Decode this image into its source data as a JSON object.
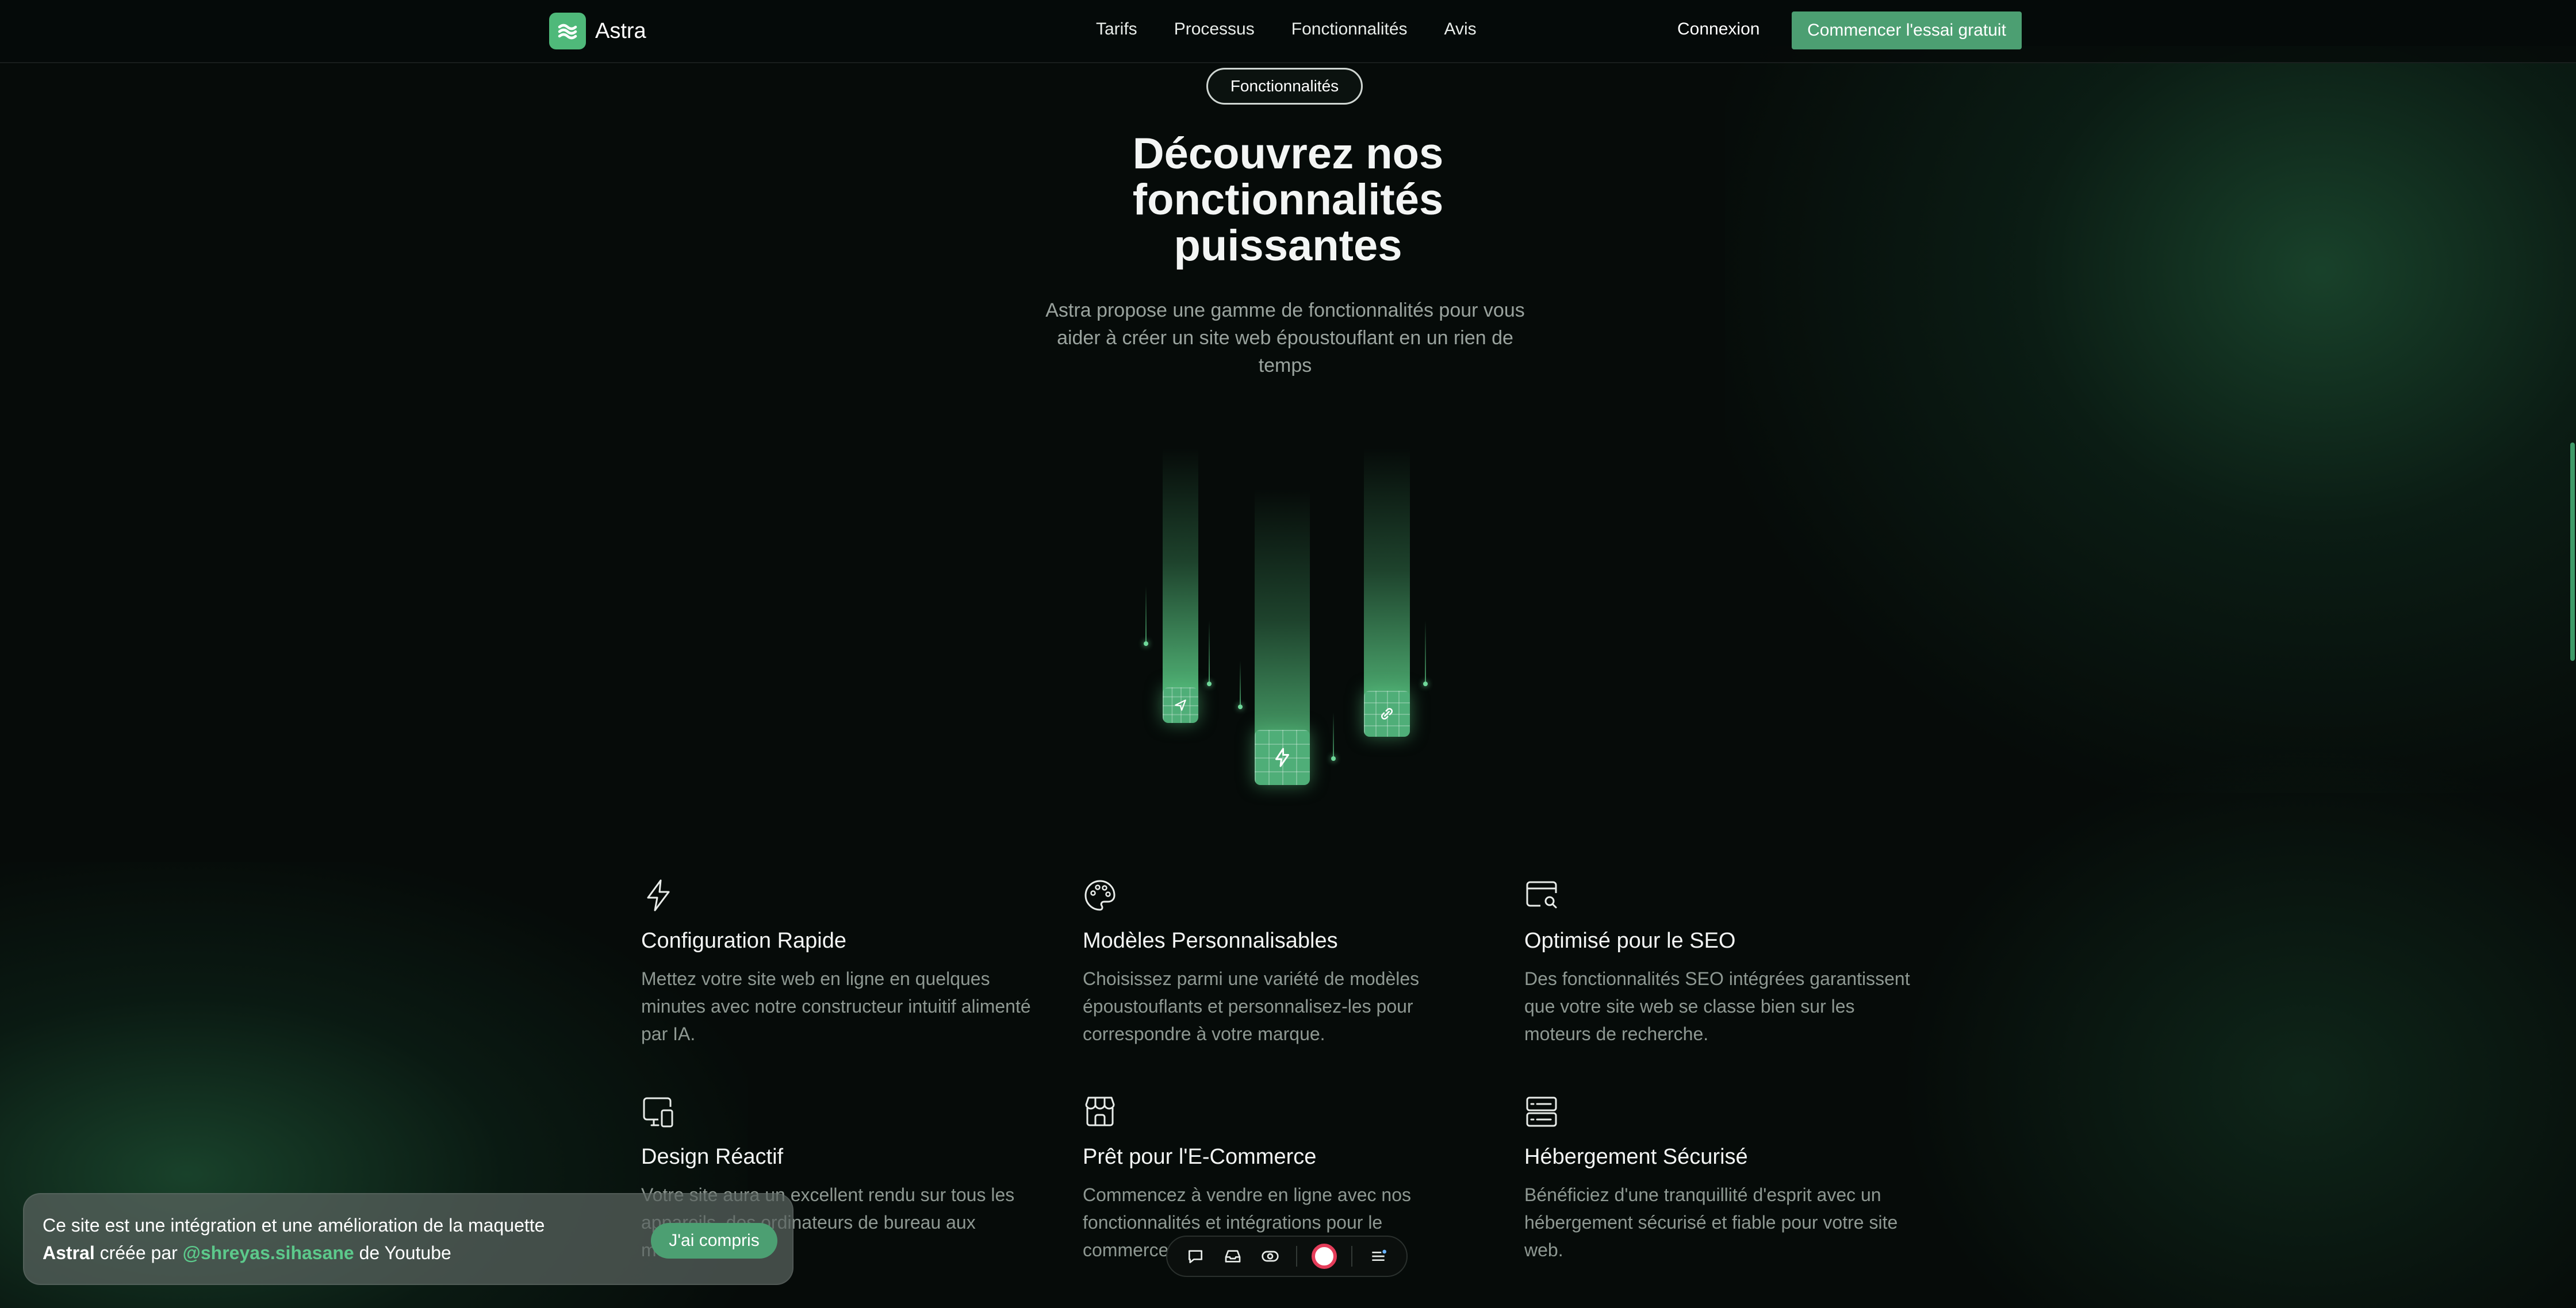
{
  "nav": {
    "brand": "Astra",
    "links": [
      "Tarifs",
      "Processus",
      "Fonctionnalités",
      "Avis"
    ],
    "login": "Connexion",
    "cta": "Commencer l'essai gratuit"
  },
  "hero": {
    "badge": "Fonctionnalités",
    "title": "Découvrez nos fonctionnalités puissantes",
    "subtitle": "Astra propose une gamme de fonctionnalités pour vous aider à créer un site web époustouflant en un rien de temps"
  },
  "illustration": {
    "tile_icons": [
      "send-icon",
      "bolt-icon",
      "link-icon"
    ]
  },
  "features": [
    {
      "icon": "bolt-icon",
      "title": "Configuration Rapide",
      "desc": "Mettez votre site web en ligne en quelques minutes avec notre constructeur intuitif alimenté par IA."
    },
    {
      "icon": "palette-icon",
      "title": "Modèles Personnalisables",
      "desc": "Choisissez parmi une variété de modèles époustouflants et personnalisez-les pour correspondre à votre marque."
    },
    {
      "icon": "search-browser-icon",
      "title": "Optimisé pour le SEO",
      "desc": "Des fonctionnalités SEO intégrées garantissent que votre site web se classe bien sur les moteurs de recherche."
    },
    {
      "icon": "devices-icon",
      "title": "Design Réactif",
      "desc": "Votre site aura un excellent rendu sur tous les appareils, des ordinateurs de bureau aux mobiles."
    },
    {
      "icon": "store-icon",
      "title": "Prêt pour l'E-Commerce",
      "desc": "Commencez à vendre en ligne avec nos fonctionnalités et intégrations pour le commerce."
    },
    {
      "icon": "server-icon",
      "title": "Hébergement Sécurisé",
      "desc": "Bénéficiez d'une tranquillité d'esprit avec un hébergement sécurisé et fiable pour votre site web."
    }
  ],
  "cookie": {
    "line1": "Ce site est une intégration et une amélioration de la maquette",
    "brand": "Astral",
    "mid": " créée par ",
    "handle": "@shreyas.sihasane",
    "end": " de Youtube",
    "button": "J'ai compris"
  },
  "toolbar": {
    "icons": [
      "comment-icon",
      "inbox-icon",
      "eye-icon",
      "record-icon",
      "menu-icon"
    ]
  },
  "colors": {
    "accent": "#4c9f72",
    "background": "#060b09",
    "handle": "#5cc98b",
    "record": "#e53d5a"
  }
}
